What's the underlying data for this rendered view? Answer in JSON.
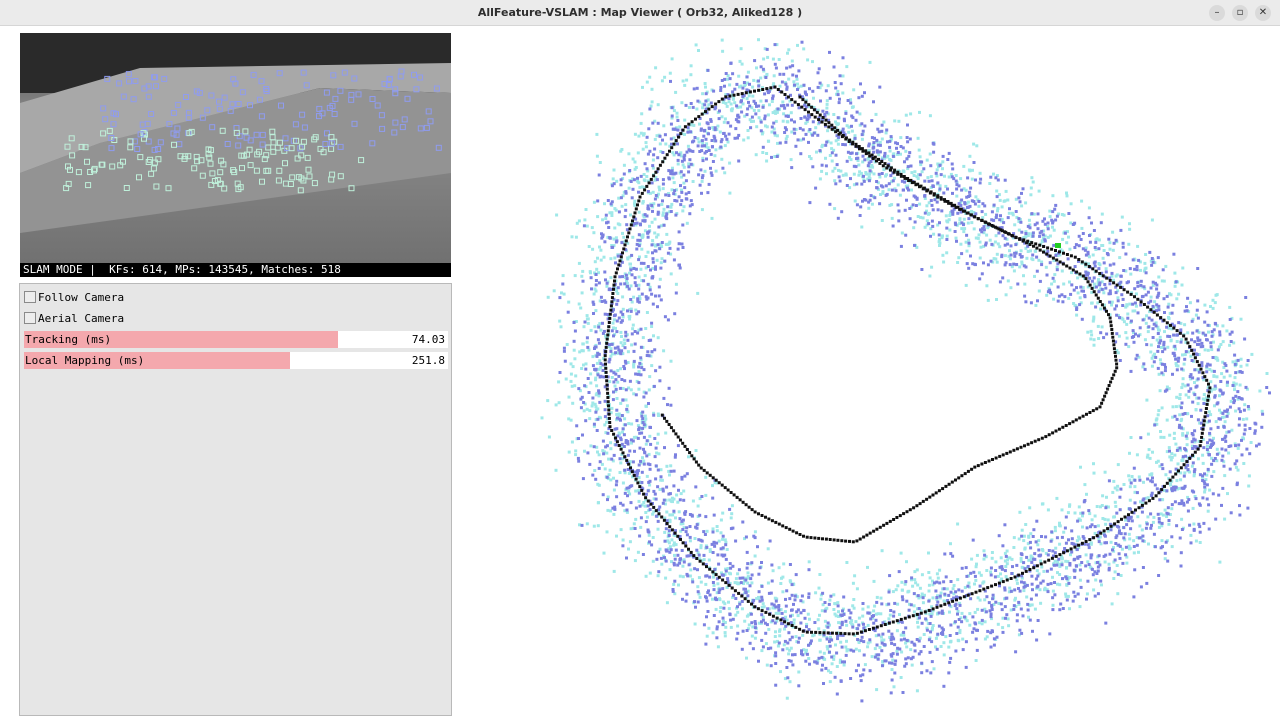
{
  "window": {
    "title": "AllFeature-VSLAM : Map Viewer ( Orb32, Aliked128 )",
    "controls": [
      "–",
      "▫",
      "✕"
    ]
  },
  "camera": {
    "status_text": "SLAM MODE |  KFs: 614, MPs: 143545, Matches: 518"
  },
  "panel": {
    "follow_camera_label": "Follow Camera",
    "aerial_camera_label": "Aerial Camera",
    "follow_camera_checked": false,
    "aerial_camera_checked": false,
    "tracking_label": "Tracking (ms)",
    "tracking_value": "74.03",
    "tracking_fill": 0.74,
    "mapping_label": "Local Mapping (ms)",
    "mapping_value": "251.8",
    "mapping_fill": 0.627
  },
  "colors": {
    "point_dark": "#7b80e0",
    "point_light": "#9fe8e8",
    "trajectory": "#111111",
    "current_pose": "#22cc22",
    "bar_fill": "#f4a8ad",
    "feature_blue": "#8f9cf0",
    "feature_green": "#bff0da"
  }
}
